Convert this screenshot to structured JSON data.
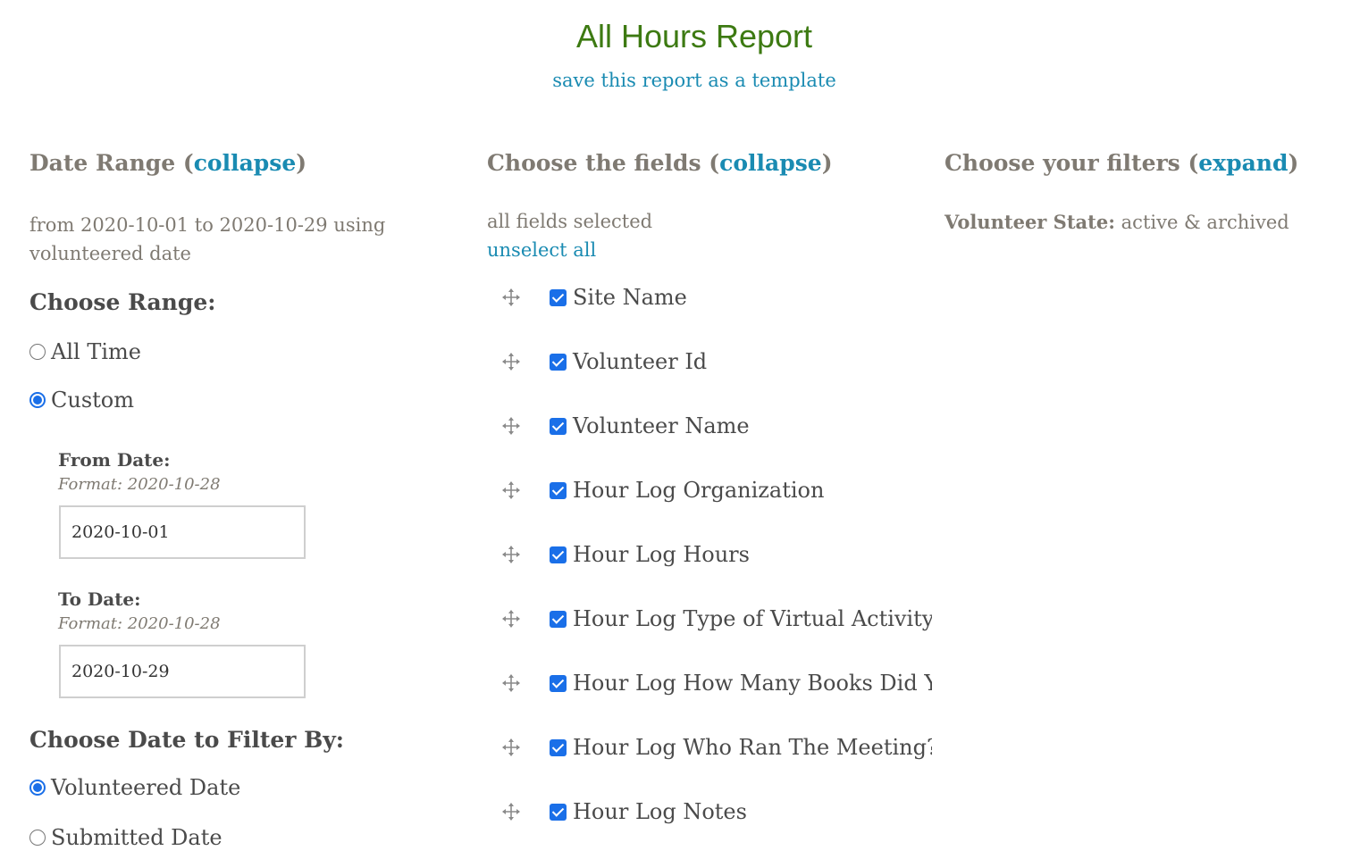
{
  "header": {
    "title": "All Hours Report",
    "save_template_link": "save this report as a template"
  },
  "date_range": {
    "heading": "Date Range",
    "toggle": "collapse",
    "summary": "from 2020-10-01 to 2020-10-29 using volunteered date",
    "choose_range_heading": "Choose Range:",
    "range_options": [
      {
        "label": "All Time",
        "selected": false
      },
      {
        "label": "Custom",
        "selected": true
      }
    ],
    "from_date": {
      "label": "From Date:",
      "hint": "Format: 2020-10-28",
      "value": "2020-10-01"
    },
    "to_date": {
      "label": "To Date:",
      "hint": "Format: 2020-10-28",
      "value": "2020-10-29"
    },
    "filter_by_heading": "Choose Date to Filter By:",
    "filter_by_options": [
      {
        "label": "Volunteered Date",
        "selected": true
      },
      {
        "label": "Submitted Date",
        "selected": false
      }
    ]
  },
  "fields": {
    "heading": "Choose the fields",
    "toggle": "collapse",
    "summary": "all fields selected",
    "unselect_all": "unselect all",
    "items": [
      {
        "label": "Site Name",
        "checked": true
      },
      {
        "label": "Volunteer Id",
        "checked": true
      },
      {
        "label": "Volunteer Name",
        "checked": true
      },
      {
        "label": "Hour Log Organization",
        "checked": true
      },
      {
        "label": "Hour Log Hours",
        "checked": true
      },
      {
        "label": "Hour Log Type of Virtual Activity",
        "checked": true
      },
      {
        "label": "Hour Log How Many Books Did You",
        "checked": true
      },
      {
        "label": "Hour Log Who Ran The Meeting?",
        "checked": true
      },
      {
        "label": "Hour Log Notes",
        "checked": true
      }
    ]
  },
  "filters": {
    "heading": "Choose your filters",
    "toggle": "expand",
    "volunteer_state_label": "Volunteer State:",
    "volunteer_state_value": "active & archived"
  },
  "colors": {
    "title_green": "#3d7a12",
    "link_blue": "#1a8bb2",
    "checkbox_blue": "#1a6fe8"
  }
}
